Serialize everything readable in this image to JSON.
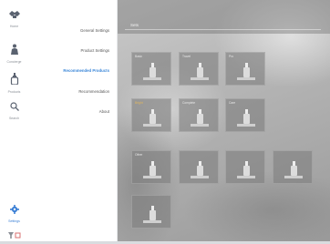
{
  "rail": {
    "items": [
      {
        "label": "Home",
        "icon": "handshake-icon"
      },
      {
        "label": "Concierge",
        "icon": "concierge-icon"
      },
      {
        "label": "Products",
        "icon": "dropper-bottle-icon"
      },
      {
        "label": "Search",
        "icon": "search-icon"
      }
    ],
    "settings_label": "Settings",
    "filter_icon": "filter-icon"
  },
  "menu": {
    "items": [
      {
        "label": "General Settings"
      },
      {
        "label": "Product Settings"
      },
      {
        "label": "Recommended Products"
      },
      {
        "label": "Recommendation"
      },
      {
        "label": "About"
      }
    ],
    "active_index": 2
  },
  "main": {
    "title": "Sets",
    "sections": [
      {
        "label": "Basic"
      },
      {
        "label": "Bright"
      },
      {
        "label": "Other"
      }
    ],
    "tiles": [
      {
        "label": "Basic"
      },
      {
        "label": "Travel"
      },
      {
        "label": "Pro"
      },
      {
        "label": "Bright",
        "highlight": true
      },
      {
        "label": "Complete"
      },
      {
        "label": "Care"
      },
      {
        "label": "Other"
      },
      {
        "label": ""
      },
      {
        "label": ""
      },
      {
        "label": ""
      },
      {
        "label": ""
      }
    ]
  },
  "colors": {
    "accent": "#3a86d8",
    "rail_bg": "#ffffff",
    "tile_bg": "#808080"
  }
}
